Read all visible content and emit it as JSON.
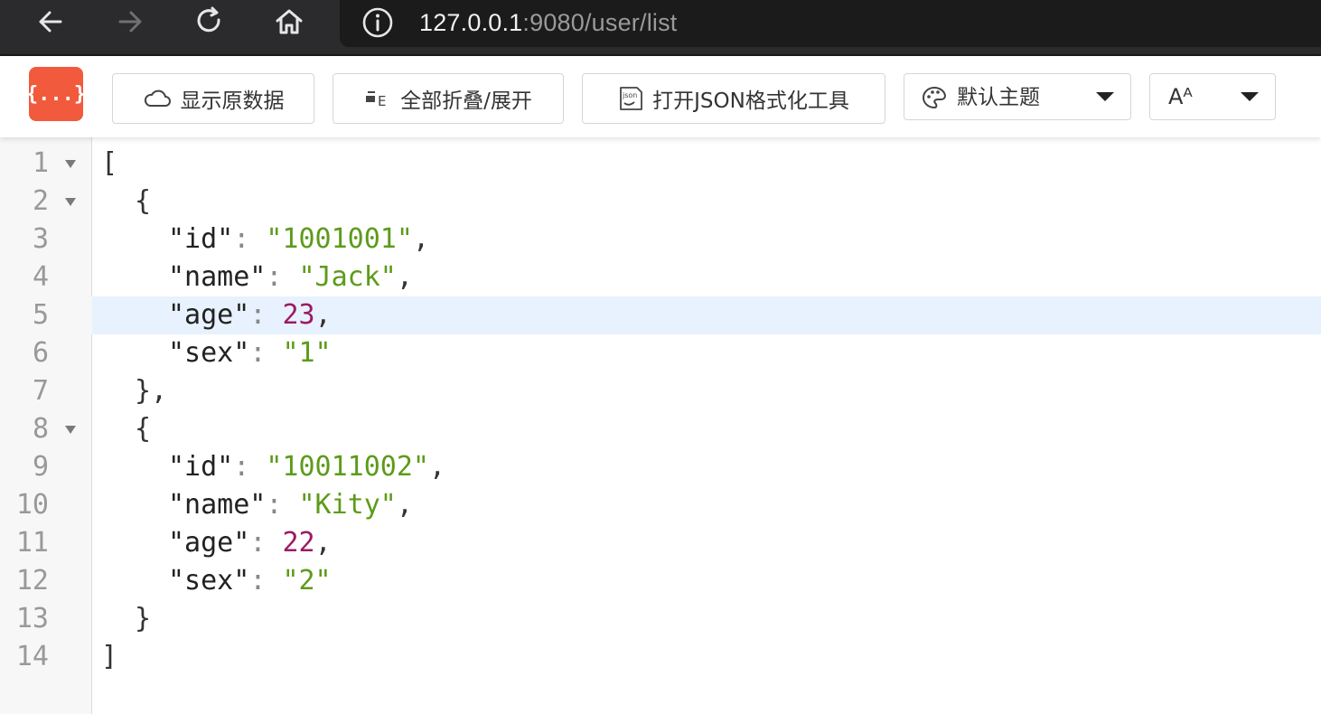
{
  "browser": {
    "url_host": "127.0.0.1",
    "url_path": ":9080/user/list"
  },
  "toolbar": {
    "logo_text": "{...}",
    "raw_label": "显示原数据",
    "collapse_label": "全部折叠/展开",
    "formatter_label": "打开JSON格式化工具",
    "theme_label": "默认主题",
    "font_label": "Aᴬ"
  },
  "colors": {
    "logo": "#f15a3c",
    "string": "#5d9b1a",
    "number": "#9b1b64",
    "active_line": "#e8f2fe"
  },
  "json_lines": [
    {
      "n": "1",
      "fold": true
    },
    {
      "n": "2",
      "fold": true
    },
    {
      "n": "3"
    },
    {
      "n": "4"
    },
    {
      "n": "5",
      "active": true
    },
    {
      "n": "6"
    },
    {
      "n": "7"
    },
    {
      "n": "8",
      "fold": true
    },
    {
      "n": "9"
    },
    {
      "n": "10"
    },
    {
      "n": "11"
    },
    {
      "n": "12"
    },
    {
      "n": "13"
    },
    {
      "n": "14"
    }
  ],
  "records": [
    {
      "id_key": "\"id\"",
      "id_val": "\"1001001\"",
      "name_key": "\"name\"",
      "name_val": "\"Jack\"",
      "age_key": "\"age\"",
      "age_val": "23",
      "sex_key": "\"sex\"",
      "sex_val": "\"1\""
    },
    {
      "id_key": "\"id\"",
      "id_val": "\"10011002\"",
      "name_key": "\"name\"",
      "name_val": "\"Kity\"",
      "age_key": "\"age\"",
      "age_val": "22",
      "sex_key": "\"sex\"",
      "sex_val": "\"2\""
    }
  ],
  "punct": {
    "arr_open": "[",
    "arr_close": "]",
    "obj_open": "{",
    "obj_close": "}",
    "obj_close_comma": "},",
    "colon": ": ",
    "comma": ","
  }
}
